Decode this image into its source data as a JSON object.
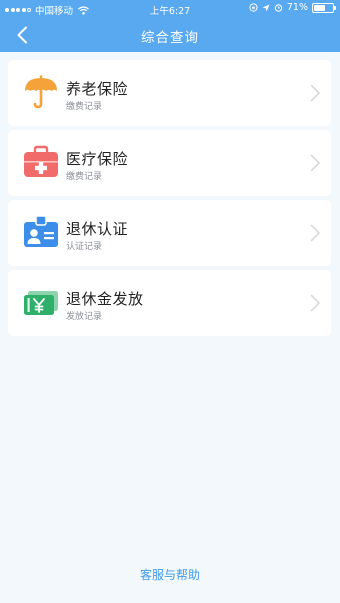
{
  "status_bar": {
    "carrier": "中国移动",
    "time": "上午6:27",
    "battery": "71%",
    "battery_level": 0.71
  },
  "navbar": {
    "title": "综合查询",
    "back_icon": "chevron-left-icon"
  },
  "items": [
    {
      "title": "养老保险",
      "subtitle": "缴费记录",
      "icon": "umbrella-icon",
      "color": "#f6a23a"
    },
    {
      "title": "医疗保险",
      "subtitle": "缴费记录",
      "icon": "medical-kit-icon",
      "color": "#f26b6b"
    },
    {
      "title": "退休认证",
      "subtitle": "认证记录",
      "icon": "id-card-icon",
      "color": "#3c8ee8"
    },
    {
      "title": "退休金发放",
      "subtitle": "发放记录",
      "icon": "money-ticket-icon",
      "color": "#2fb06a"
    }
  ],
  "footer": {
    "help_label": "客服与帮助"
  },
  "colors": {
    "header": "#58a9f0",
    "background": "#f3f8fd",
    "link": "#3f9ae6"
  }
}
